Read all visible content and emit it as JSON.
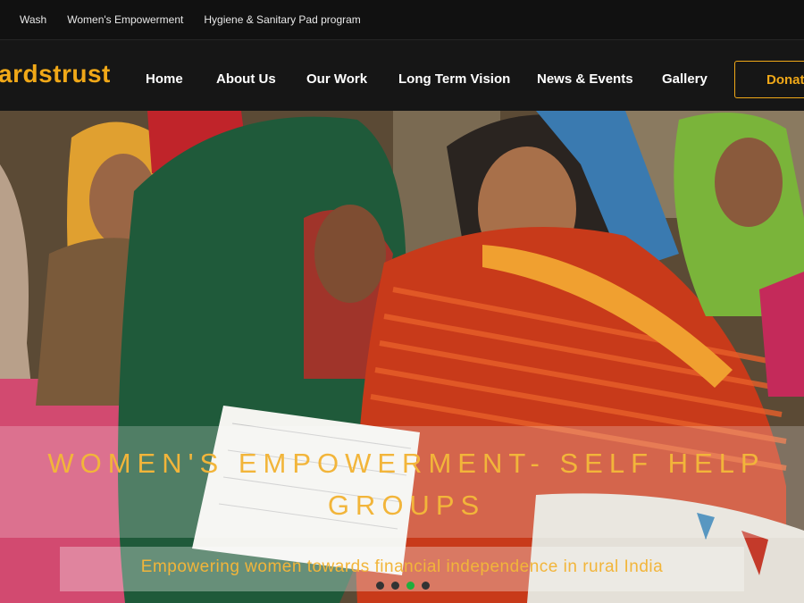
{
  "topbar": {
    "links": [
      "Wash",
      "Women's Empowerment",
      "Hygiene & Sanitary Pad program"
    ]
  },
  "navbar": {
    "brand": "ardstrust",
    "items": [
      "Home",
      "About Us",
      "Our Work",
      "Long Term Vision",
      "News & Events",
      "Gallery"
    ],
    "donate_label": "Donat"
  },
  "hero": {
    "title": "Women's Empowerment- Self Help Groups",
    "subtitle": "Empowering women towards financial independence in rural India",
    "slides": 4,
    "active_slide": 3
  },
  "colors": {
    "accent": "#f0a818",
    "active_dot": "#1fae3c",
    "bar_bg": "#111111"
  }
}
